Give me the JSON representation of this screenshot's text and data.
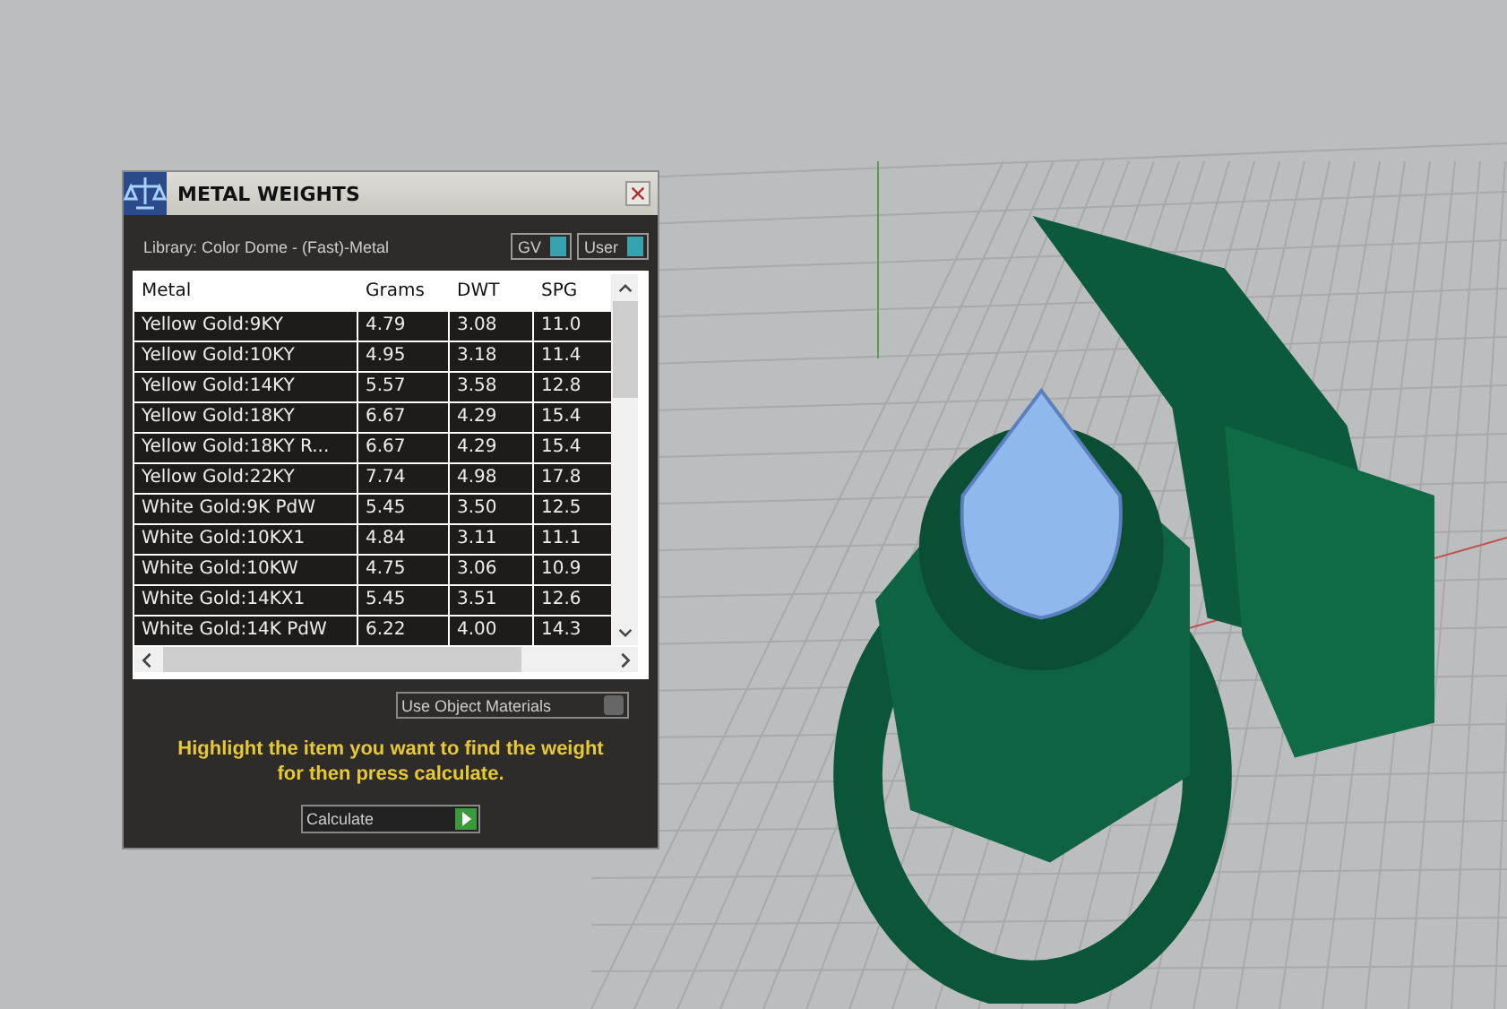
{
  "window": {
    "title": "METAL WEIGHTS"
  },
  "library": "Library: Color Dome - (Fast)-Metal",
  "toggles": [
    {
      "label": "GV",
      "on": true
    },
    {
      "label": "User",
      "on": true
    }
  ],
  "table": {
    "columns": [
      "Metal",
      "Grams",
      "DWT",
      "SPG"
    ],
    "rows": [
      [
        "Yellow Gold:9KY",
        "4.79",
        "3.08",
        "11.0"
      ],
      [
        "Yellow Gold:10KY",
        "4.95",
        "3.18",
        "11.4"
      ],
      [
        "Yellow Gold:14KY",
        "5.57",
        "3.58",
        "12.8"
      ],
      [
        "Yellow Gold:18KY",
        "6.67",
        "4.29",
        "15.4"
      ],
      [
        "Yellow Gold:18KY R...",
        "6.67",
        "4.29",
        "15.4"
      ],
      [
        "Yellow Gold:22KY",
        "7.74",
        "4.98",
        "17.8"
      ],
      [
        "White Gold:9K PdW",
        "5.45",
        "3.50",
        "12.5"
      ],
      [
        "White Gold:10KX1",
        "4.84",
        "3.11",
        "11.1"
      ],
      [
        "White Gold:10KW",
        "4.75",
        "3.06",
        "10.9"
      ],
      [
        "White Gold:14KX1",
        "5.45",
        "3.51",
        "12.6"
      ],
      [
        "White Gold:14K PdW",
        "6.22",
        "4.00",
        "14.3"
      ]
    ]
  },
  "use_object_materials": {
    "label": "Use Object Materials",
    "on": false
  },
  "hint": "Highlight the item you want to find the weight for then press calculate.",
  "calculate_button": "Calculate"
}
